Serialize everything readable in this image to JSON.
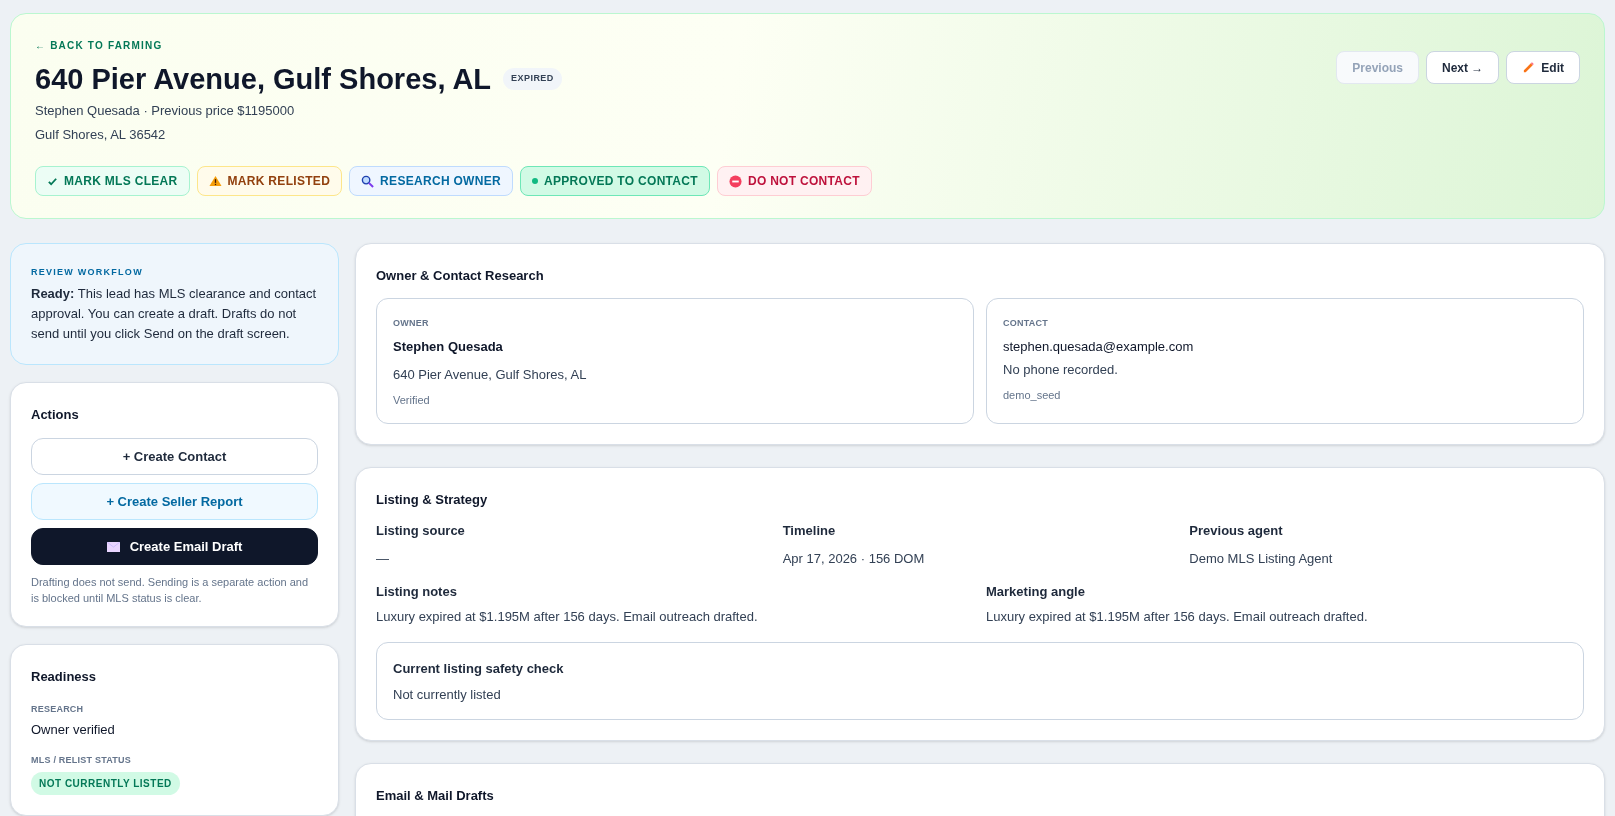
{
  "header": {
    "back_link": "← BACK TO FARMING",
    "title": "640 Pier Avenue, Gulf Shores, AL",
    "status_badge": "EXPIRED",
    "subtitle": "Stephen Quesada · Previous price $1195000",
    "location": "Gulf Shores, AL 36542",
    "nav_buttons": [
      {
        "label": "Previous",
        "kind": "plain",
        "disabled": true
      },
      {
        "label": "Next →",
        "kind": "plain",
        "disabled": false
      },
      {
        "label": "Edit",
        "kind": "edit",
        "disabled": false
      }
    ],
    "status_actions": [
      {
        "label": "MARK MLS CLEAR",
        "kind": "check"
      },
      {
        "label": "MARK RELISTED",
        "kind": "warning"
      },
      {
        "label": "RESEARCH OWNER",
        "kind": "search"
      },
      {
        "label": "APPROVED TO CONTACT",
        "kind": "dot"
      },
      {
        "label": "DO NOT CONTACT",
        "kind": "stop"
      }
    ]
  },
  "review_workflow": {
    "heading": "REVIEW WORKFLOW",
    "message": "**Ready:** This lead has MLS clearance and contact approval. You can create a draft. Drafts do not send until you click Send on the draft screen."
  },
  "actions": {
    "title": "Actions",
    "buttons": [
      {
        "label": "+ Create Contact",
        "kind": "outline"
      },
      {
        "label": "+ Create Seller Report",
        "kind": "soft"
      },
      {
        "label": "Create Email Draft",
        "kind": "primary"
      }
    ],
    "note": "Drafting does not send. Sending is a separate action and is blocked until MLS status is clear."
  },
  "readiness": {
    "title": "Readiness",
    "research_label": "RESEARCH",
    "research_value": "Owner verified",
    "mls_label": "MLS / RELIST STATUS",
    "mls_badge": "NOT CURRENTLY LISTED"
  },
  "owner_contact": {
    "title": "Owner & Contact Research",
    "owner": {
      "label": "OWNER",
      "name": "Stephen Quesada",
      "address": "640 Pier Avenue, Gulf Shores, AL",
      "status": "Verified"
    },
    "contact": {
      "label": "CONTACT",
      "email": "stephen.quesada@example.com",
      "phone": "No phone recorded.",
      "source": "demo_seed"
    }
  },
  "listing_strategy": {
    "title": "Listing & Strategy",
    "fields": [
      {
        "label": "Listing source",
        "value": "—"
      },
      {
        "label": "Timeline",
        "value": "Apr 17, 2026 · 156 DOM"
      },
      {
        "label": "Previous agent",
        "value": "Demo MLS Listing Agent"
      }
    ],
    "notes": [
      {
        "label": "Listing notes",
        "value": "Luxury expired at $1.195M after 156 days. Email outreach drafted."
      },
      {
        "label": "Marketing angle",
        "value": "Luxury expired at $1.195M after 156 days. Email outreach drafted."
      }
    ],
    "safety_check": {
      "title": "Current listing safety check",
      "value": "Not currently listed"
    }
  },
  "email_drafts": {
    "title": "Email & Mail Drafts"
  }
}
